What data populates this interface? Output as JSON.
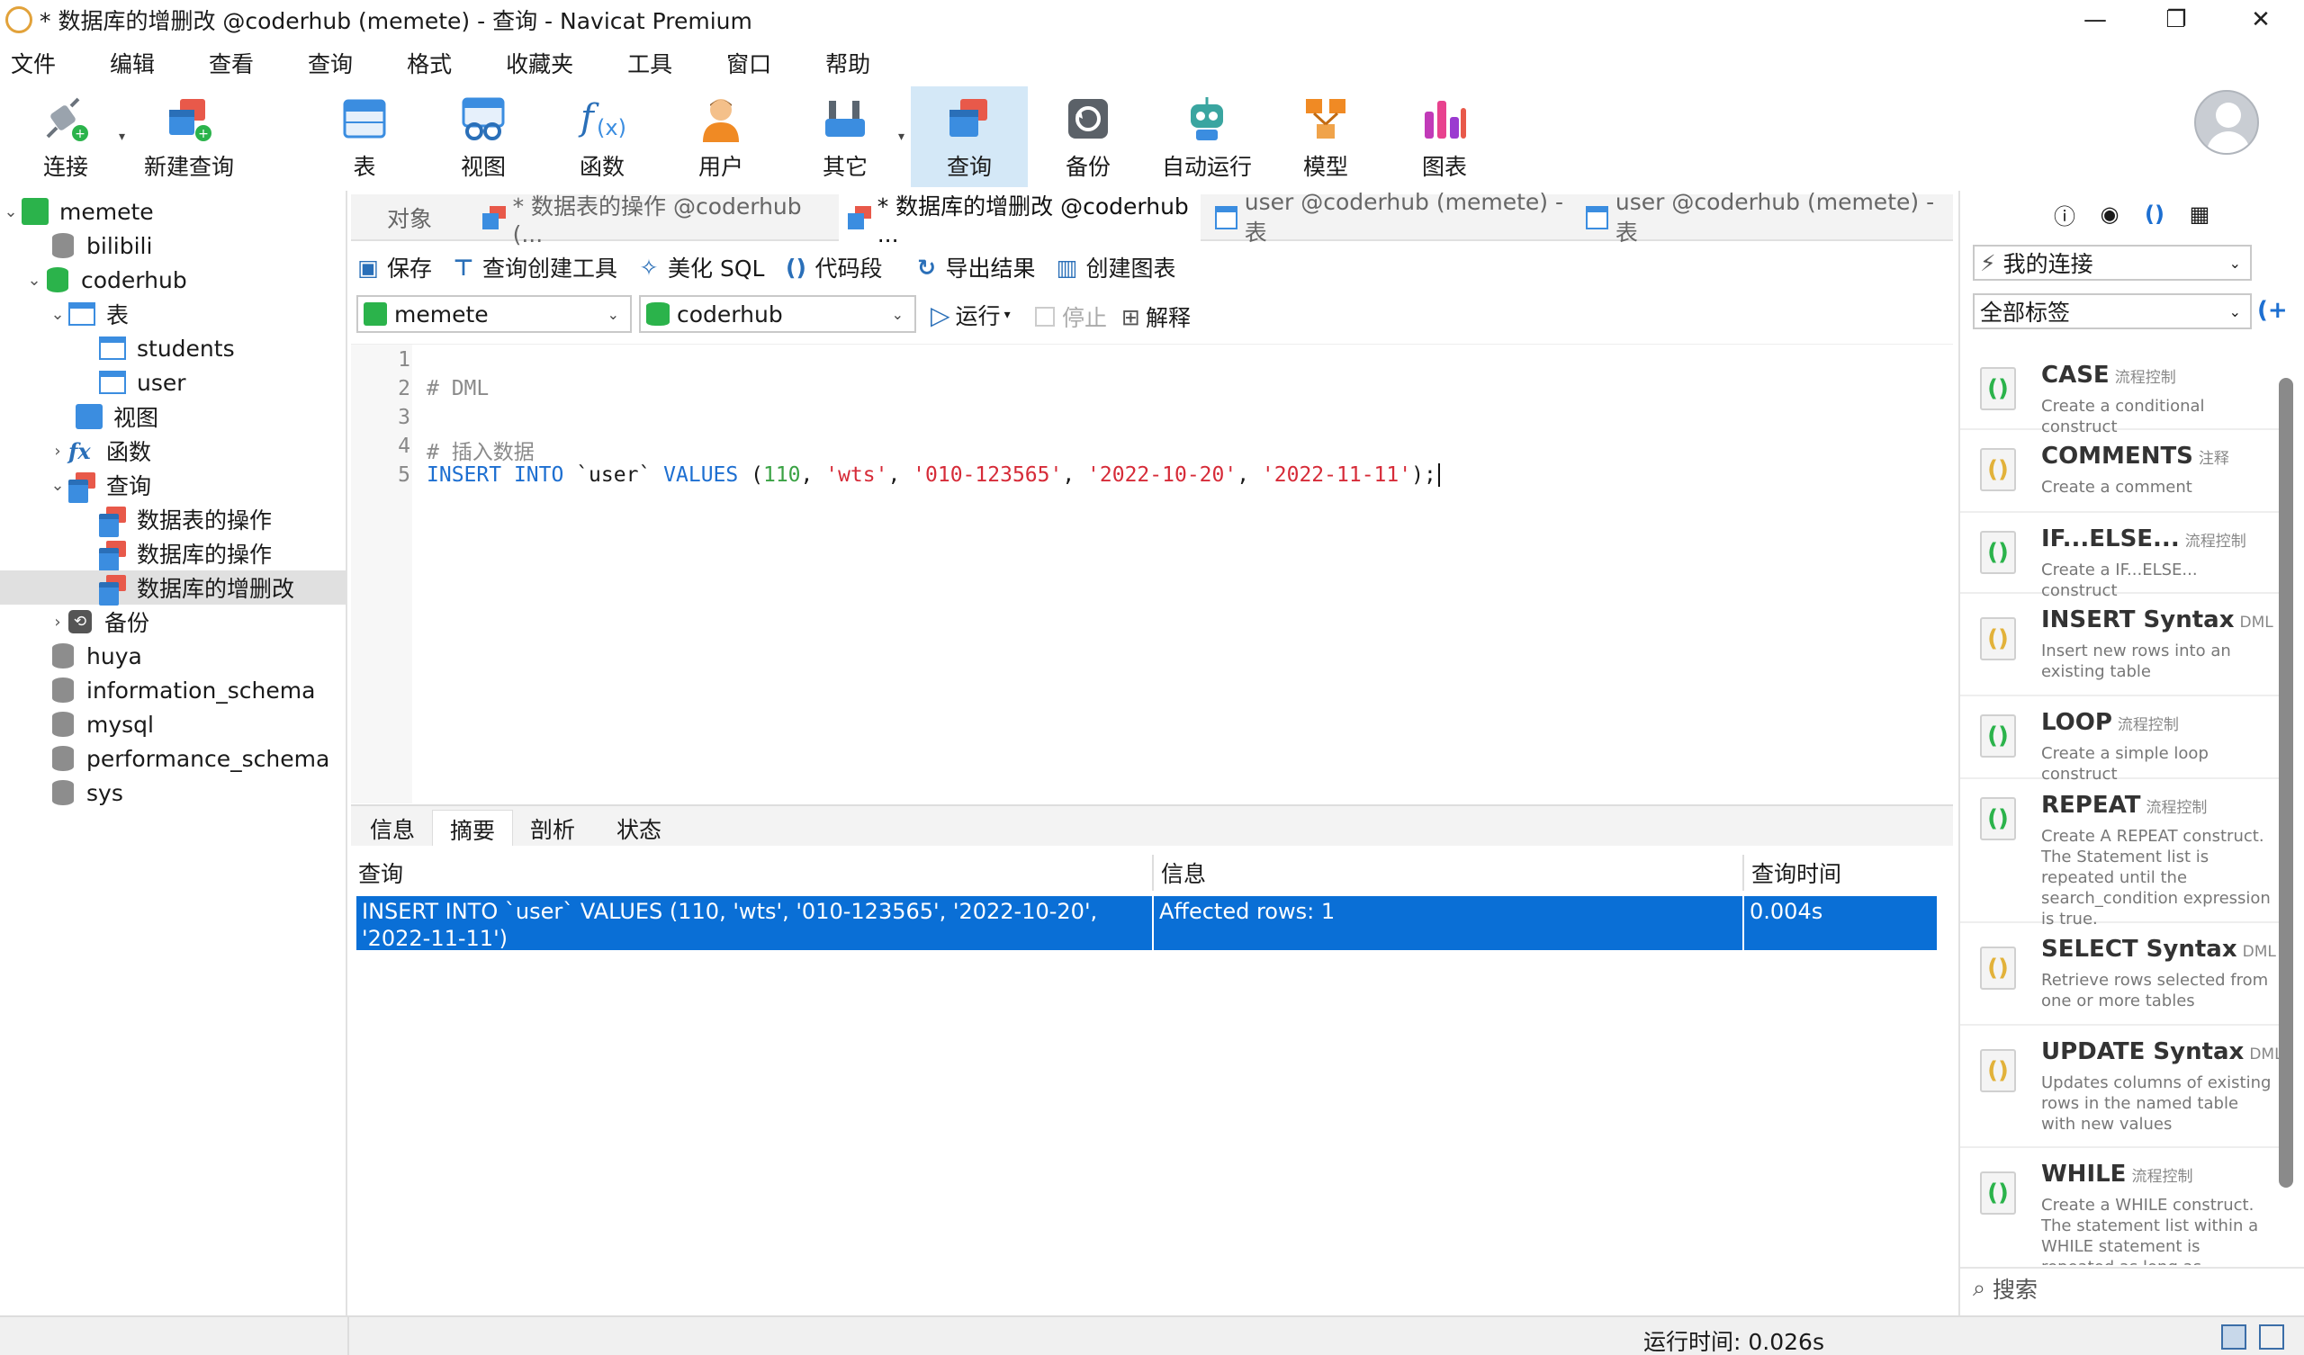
{
  "window": {
    "title": "* 数据库的增删改 @coderhub (memete) - 查询 - Navicat Premium",
    "minimize": "—",
    "maximize": "❐",
    "close": "✕"
  },
  "menu": [
    "文件",
    "编辑",
    "查看",
    "查询",
    "格式",
    "收藏夹",
    "工具",
    "窗口",
    "帮助"
  ],
  "toolbar": {
    "connect": "连接",
    "new_query": "新建查询",
    "table": "表",
    "view": "视图",
    "function": "函数",
    "user": "用户",
    "other": "其它",
    "query": "查询",
    "backup": "备份",
    "automation": "自动运行",
    "model": "模型",
    "chart": "图表"
  },
  "tree": {
    "connection": "memete",
    "db_bilibili": "bilibili",
    "db_coderhub": "coderhub",
    "tables": "表",
    "table_students": "students",
    "table_user": "user",
    "views": "视图",
    "functions": "函数",
    "queries": "查询",
    "query_1": "数据表的操作",
    "query_2": "数据库的操作",
    "query_3": "数据库的增删改",
    "backups": "备份",
    "db_huya": "huya",
    "db_information_schema": "information_schema",
    "db_mysql": "mysql",
    "db_performance_schema": "performance_schema",
    "db_sys": "sys"
  },
  "tabs": {
    "objects": "对象",
    "tab1": "* 数据表的操作 @coderhub (...",
    "tab2": "* 数据库的增删改 @coderhub ...",
    "tab3": "user @coderhub (memete) - 表",
    "tab4": "user @coderhub (memete) - 表"
  },
  "query_toolbar": {
    "save": "保存",
    "builder": "查询创建工具",
    "beautify": "美化 SQL",
    "snippet": "代码段",
    "export": "导出结果",
    "create_chart": "创建图表",
    "connection_select": "memete",
    "database_select": "coderhub",
    "run": "运行",
    "stop": "停止",
    "explain": "解释"
  },
  "editor": {
    "line_numbers": [
      "1",
      "2",
      "3",
      "4",
      "5"
    ],
    "line2": "# DML",
    "line4": "# 插入数据",
    "l5_kw1": "INSERT",
    "l5_kw2": "INTO",
    "l5_tbl": "`user`",
    "l5_kw3": "VALUES",
    "l5_open": "(",
    "l5_num": "110",
    "l5_s1": "'wts'",
    "l5_s2": "'010-123565'",
    "l5_s3": "'2022-10-20'",
    "l5_s4": "'2022-11-11'",
    "l5_close": ");"
  },
  "result_tabs": [
    "信息",
    "摘要",
    "剖析",
    "状态"
  ],
  "result_grid": {
    "headers": [
      "查询",
      "信息",
      "查询时间"
    ],
    "row": {
      "query": "INSERT INTO `user` VALUES (110, 'wts', '010-123565', '2022-10-20', '2022-11-11')",
      "info": "Affected rows: 1",
      "time": "0.004s"
    }
  },
  "right_panel": {
    "connection_select": "我的连接",
    "tag_select": "全部标签",
    "search_placeholder": "搜索",
    "snippets": [
      {
        "title": "CASE",
        "tag": "流程控制",
        "desc": "Create a conditional construct"
      },
      {
        "title": "COMMENTS",
        "tag": "注释",
        "desc": "Create a comment"
      },
      {
        "title": "IF...ELSE...",
        "tag": "流程控制",
        "desc": "Create a IF...ELSE... construct"
      },
      {
        "title": "INSERT Syntax",
        "tag": "DML",
        "desc": "Insert new rows into an existing table"
      },
      {
        "title": "LOOP",
        "tag": "流程控制",
        "desc": "Create a simple loop construct"
      },
      {
        "title": "REPEAT",
        "tag": "流程控制",
        "desc": "Create A REPEAT construct. The Statement list is repeated until the search_condition expression is true."
      },
      {
        "title": "SELECT Syntax",
        "tag": "DML",
        "desc": "Retrieve rows selected from one or more tables"
      },
      {
        "title": "UPDATE Syntax",
        "tag": "DML",
        "desc": "Updates columns of existing rows in the named table with new values"
      },
      {
        "title": "WHILE",
        "tag": "流程控制",
        "desc": "Create a WHILE construct. The statement list within a WHILE statement is repeated as long as"
      }
    ]
  },
  "status_bar": {
    "run_time": "运行时间: 0.026s"
  },
  "colors": {
    "selection": "#0a6fd6",
    "keyword": "#1d6fd1",
    "string": "#d62b38",
    "number": "#3aa244",
    "active_tool": "#d4e8f7"
  }
}
